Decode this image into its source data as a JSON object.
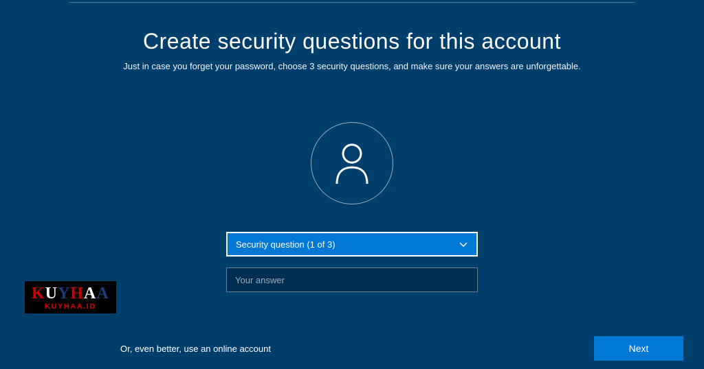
{
  "header": {
    "title": "Create security questions for this account",
    "subtitle": "Just in case you forget your password, choose 3 security questions, and make sure your answers are unforgettable."
  },
  "form": {
    "question_select": "Security question (1 of 3)",
    "answer_placeholder": "Your answer"
  },
  "footer": {
    "online_link": "Or, even better, use an online account",
    "next_button": "Next"
  },
  "watermark": {
    "brand": "KUYHAA",
    "site": "KUYHAA.ID"
  },
  "colors": {
    "background": "#003e6b",
    "accent": "#0078d4"
  }
}
